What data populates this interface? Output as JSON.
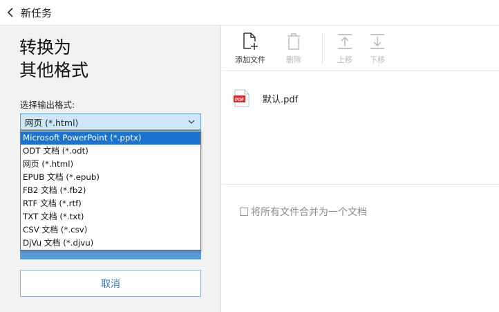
{
  "window": {
    "title": "新任务"
  },
  "left_panel": {
    "heading_line1": "转换为",
    "heading_line2": "其他格式",
    "format_label": "选择输出格式:",
    "selected_format": "网页 (*.html)",
    "cancel_label": "取消"
  },
  "dropdown": {
    "items": [
      "Microsoft PowerPoint (*.pptx)",
      "ODT 文档 (*.odt)",
      "网页 (*.html)",
      "EPUB 文档 (*.epub)",
      "FB2 文档 (*.fb2)",
      "RTF 文档 (*.rtf)",
      "TXT 文档 (*.txt)",
      "CSV 文档 (*.csv)",
      "DjVu 文档 (*.djvu)"
    ],
    "highlighted_index": 0
  },
  "toolbar": {
    "add_file": "添加文件",
    "delete": "删除",
    "move_up": "上移",
    "move_down": "下移"
  },
  "files": [
    {
      "name": "默认.pdf",
      "icon_text": "PDF"
    }
  ],
  "merge": {
    "label": "将所有文件合并为一个文档",
    "checked": false
  },
  "colors": {
    "accent": "#1a73d1",
    "button_blue": "#5b9ad8",
    "cancel_text": "#2e79c2",
    "pdf_red": "#d32f2f"
  }
}
